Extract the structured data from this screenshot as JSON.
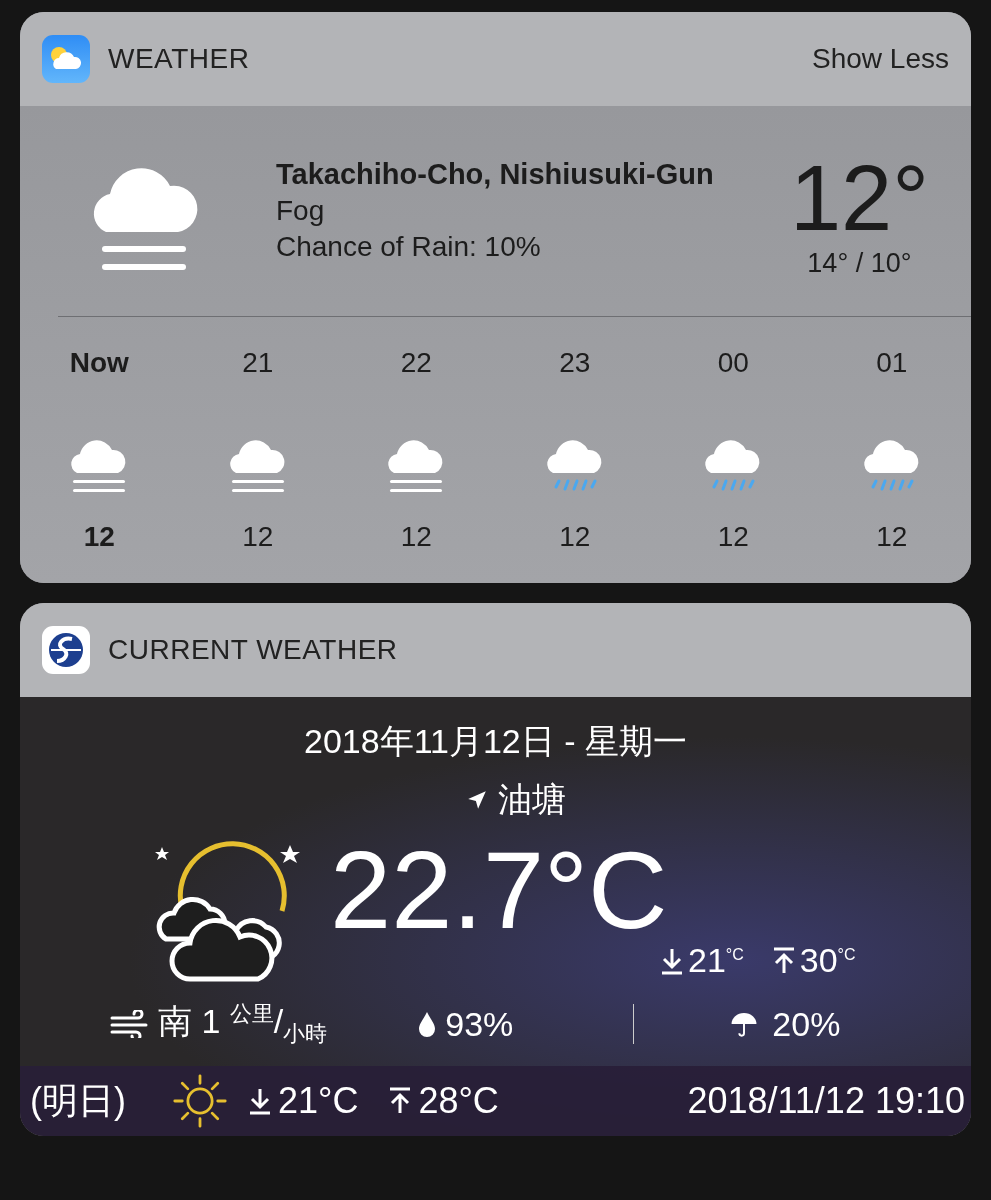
{
  "weather_widget": {
    "app_name": "WEATHER",
    "show_less": "Show Less",
    "current": {
      "location": "Takachiho-Cho, Nishiusuki-Gun",
      "condition": "Fog",
      "rain_chance": "Chance of Rain: 10%",
      "temperature": "12°",
      "high_low": "14° / 10°"
    },
    "hourly": [
      {
        "time": "Now",
        "kind": "fog",
        "temp": "12",
        "selected": true
      },
      {
        "time": "21",
        "kind": "fog",
        "temp": "12",
        "selected": false
      },
      {
        "time": "22",
        "kind": "fog",
        "temp": "12",
        "selected": false
      },
      {
        "time": "23",
        "kind": "rain",
        "temp": "12",
        "selected": false
      },
      {
        "time": "00",
        "kind": "rain",
        "temp": "12",
        "selected": false
      },
      {
        "time": "01",
        "kind": "rain",
        "temp": "12",
        "selected": false
      }
    ]
  },
  "current_weather_widget": {
    "app_name": "CURRENT WEATHER",
    "date": "2018年11月12日 - 星期一",
    "location": "油塘",
    "temperature": "22.7°C",
    "low": "21$^{°C}$",
    "high": "30$^{°C}$",
    "wind": "南 1 $^{公里}$/$_{小時}$",
    "humidity": "93%",
    "rain_chance": "20%",
    "tomorrow": {
      "label": "(明日)",
      "low": "21°C",
      "high": "28°C"
    },
    "updated": "2018/11/12 19:10"
  }
}
